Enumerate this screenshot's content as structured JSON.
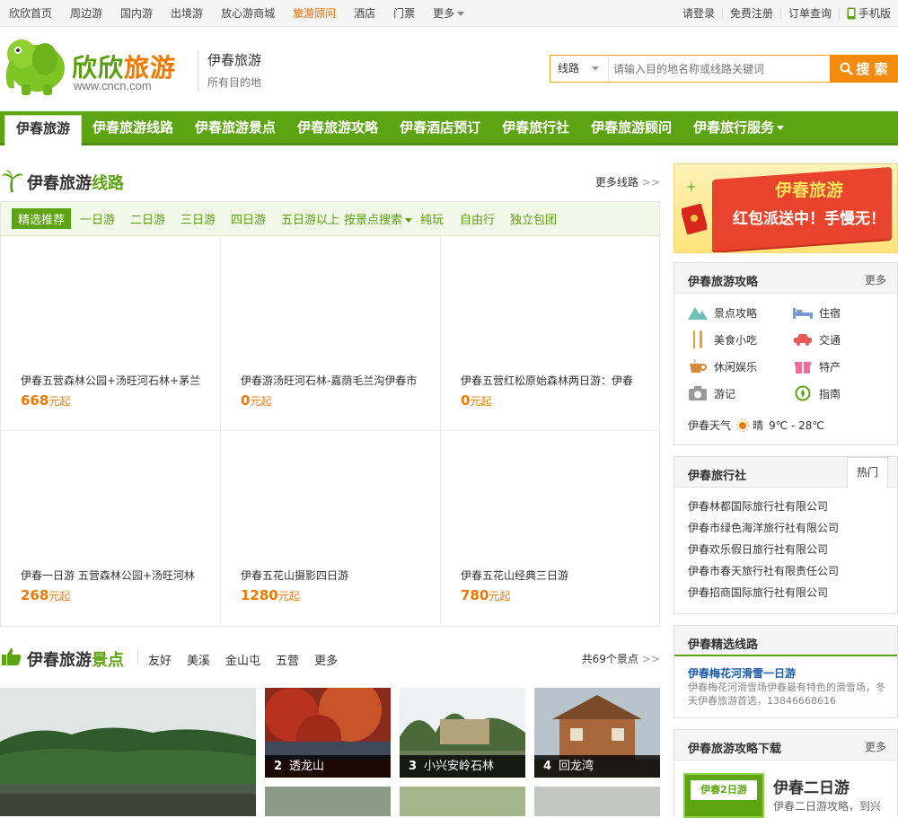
{
  "topbar": {
    "left": [
      "欣欣首页",
      "周边游",
      "国内游",
      "出境游",
      "放心游商城",
      "旅游顾问",
      "酒店",
      "门票",
      "更多"
    ],
    "right": [
      "请登录",
      "免费注册",
      "订单查询",
      "手机版"
    ]
  },
  "header": {
    "brand": "欣欣旅游",
    "brand_url": "www.cncn.com",
    "city_title": "伊春旅游",
    "city_sub": "所有目的地"
  },
  "search": {
    "type": "线路",
    "placeholder": "请输入目的地名称或线路关键词",
    "button": "搜 索"
  },
  "nav": [
    "伊春旅游",
    "伊春旅游线路",
    "伊春旅游景点",
    "伊春旅游攻略",
    "伊春酒店预订",
    "伊春旅行社",
    "伊春旅游顾问",
    "伊春旅行服务"
  ],
  "routes": {
    "title_a": "伊春旅游",
    "title_b": "线路",
    "more": "更多线路",
    "tabs": [
      "精选推荐",
      "一日游",
      "二日游",
      "三日游",
      "四日游",
      "五日游以上",
      "按景点搜索",
      "纯玩",
      "自由行",
      "独立包团"
    ],
    "cards": [
      {
        "title": "伊春五营森林公园+汤旺河石林+茅兰",
        "price": "668",
        "unit": "元起"
      },
      {
        "title": "伊春游汤旺河石林-嘉荫毛兰沟伊春市",
        "price": "0",
        "unit": "元起"
      },
      {
        "title": "伊春五营红松原始森林两日游：伊春",
        "price": "0",
        "unit": "元起"
      },
      {
        "title": "伊春一日游 五营森林公园+汤旺河林",
        "price": "268",
        "unit": "元起"
      },
      {
        "title": "伊春五花山摄影四日游",
        "price": "1280",
        "unit": "元起"
      },
      {
        "title": "伊春五花山经典三日游",
        "price": "780",
        "unit": "元起"
      }
    ]
  },
  "scenic": {
    "title_a": "伊春旅游",
    "title_b": "景点",
    "links": [
      "友好",
      "美溪",
      "金山屯",
      "五营",
      "更多"
    ],
    "count": "共69个景点",
    "thumbs": [
      {
        "num": "2",
        "name": "透龙山"
      },
      {
        "num": "3",
        "name": "小兴安岭石林"
      },
      {
        "num": "4",
        "name": "回龙湾"
      }
    ]
  },
  "promo": {
    "line1": "伊春旅游",
    "line2": "红包派送中！手慢无！"
  },
  "guide": {
    "title": "伊春旅游攻略",
    "more": "更多",
    "items": [
      "景点攻略",
      "住宿",
      "美食小吃",
      "交通",
      "休闲娱乐",
      "特产",
      "游记",
      "指南"
    ],
    "weather_label": "伊春天气",
    "weather": "晴",
    "temp": "9℃ - 28℃"
  },
  "agencies": {
    "title": "伊春旅行社",
    "tab": "热门",
    "list": [
      "伊春林都国际旅行社有限公司",
      "伊春市绿色海洋旅行社有限公司",
      "伊春欢乐假日旅行社有限公司",
      "伊春市春天旅行社有限责任公司",
      "伊春招商国际旅行社有限公司"
    ]
  },
  "picked": {
    "title": "伊春精选线路",
    "route_title": "伊春梅花河滑雪一日游",
    "route_desc": "伊春梅花河滑雪场伊春最有特色的滑雪场，冬天伊春旅游首选，13846668616"
  },
  "download": {
    "title": "伊春旅游攻略下载",
    "more": "更多",
    "book_title": "伊春二日游",
    "book_desc": "伊春二日游攻略，到兴",
    "cover_text": "伊春2日游"
  },
  "colors": {
    "green": "#5da412",
    "orange": "#f07800"
  }
}
